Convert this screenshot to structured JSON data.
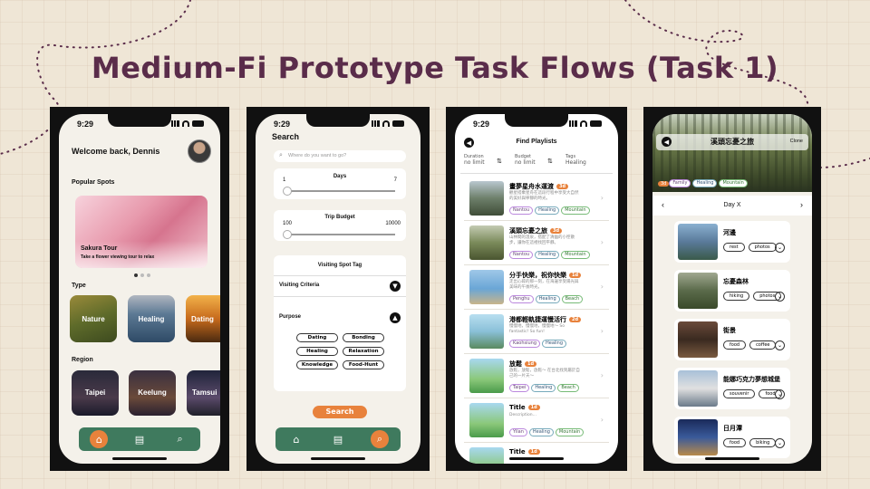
{
  "slide": {
    "title": "Medium-Fi Prototype Task Flows (Task 1)"
  },
  "status_time": "9:29",
  "screen1": {
    "greeting": "Welcome back, Dennis",
    "popular_heading": "Popular Spots",
    "feature_title": "Sakura Tour",
    "feature_sub": "Take a flower viewing tour to relax",
    "type_heading": "Type",
    "types": [
      "Nature",
      "Healing",
      "Dating"
    ],
    "region_heading": "Region",
    "regions": [
      "Taipei",
      "Keelung",
      "Tamsui"
    ]
  },
  "screen2": {
    "title": "Search",
    "search_placeholder": "Where do you want to go?",
    "days_label": "Days",
    "days_min": "1",
    "days_max": "7",
    "budget_label": "Trip Budget",
    "budget_min": "100",
    "budget_max": "10000",
    "tag_heading": "Visiting Spot Tag",
    "criteria_label": "Visiting Criteria",
    "purpose_label": "Purpose",
    "tags": [
      "Dating",
      "Bonding",
      "Healing",
      "Relaxation",
      "Knowledge",
      "Food-Hunt"
    ],
    "search_button": "Search"
  },
  "screen3": {
    "title": "Find Playlists",
    "filters": [
      {
        "label": "Duration",
        "value": "no limit"
      },
      {
        "label": "Budget",
        "value": "no limit"
      },
      {
        "label": "Tags",
        "value": "Healing"
      }
    ],
    "items": [
      {
        "name": "畫夢星舟水運渡",
        "badge": "3d",
        "desc": "觀星搭乘星舟在這段行程中享受大自然的美好與寧靜的時光。",
        "tags": [
          "Nantou",
          "Healing",
          "Mountain"
        ]
      },
      {
        "name": "溪頭忘憂之旅",
        "badge": "3d",
        "desc": "山林間的溫泉，搭配了清幽的小徑散步，讓你在這裡找回平靜。",
        "tags": [
          "Nantou",
          "Healing",
          "Mountain"
        ]
      },
      {
        "name": "分手快樂，祝你快樂",
        "badge": "1d",
        "desc": "走出心碎的那一刻，在海邊享受陽光與美味的午後時光。",
        "tags": [
          "Penghu",
          "Healing",
          "Beach"
        ]
      },
      {
        "name": "港都輕軌捷運慢活行",
        "badge": "2d",
        "desc": "慢慢地，慢慢地，慢慢地～ So fantastic! So fun!",
        "tags": [
          "Kaohsiung",
          "Healing"
        ]
      },
      {
        "name": "放鬆",
        "badge": "1d",
        "desc": "放鬆，放鬆，放鬆～ 在台北找到屬於自己的一片天～",
        "tags": [
          "Taipei",
          "Healing",
          "Beach"
        ]
      },
      {
        "name": "Title",
        "badge": "1d",
        "desc": "Description...",
        "tags": [
          "Yilan",
          "Healing",
          "Mountain"
        ]
      },
      {
        "name": "Title",
        "badge": "1d",
        "desc": "",
        "tags": []
      }
    ]
  },
  "screen4": {
    "title": "溪頭忘憂之旅",
    "clone_label": "Clone",
    "tags": [
      "3d",
      "Family",
      "Healing",
      "Mountain"
    ],
    "day_label": "Day X",
    "spots": [
      {
        "name": "河邊",
        "tags": [
          "rest",
          "photos"
        ]
      },
      {
        "name": "忘憂森林",
        "tags": [
          "hiking",
          "photos"
        ]
      },
      {
        "name": "街景",
        "tags": [
          "food",
          "coffee"
        ]
      },
      {
        "name": "能娜巧克力夢想城堡",
        "tags": [
          "souvenir",
          "food"
        ]
      },
      {
        "name": "日月潭",
        "tags": [
          "food",
          "biking"
        ]
      }
    ]
  }
}
